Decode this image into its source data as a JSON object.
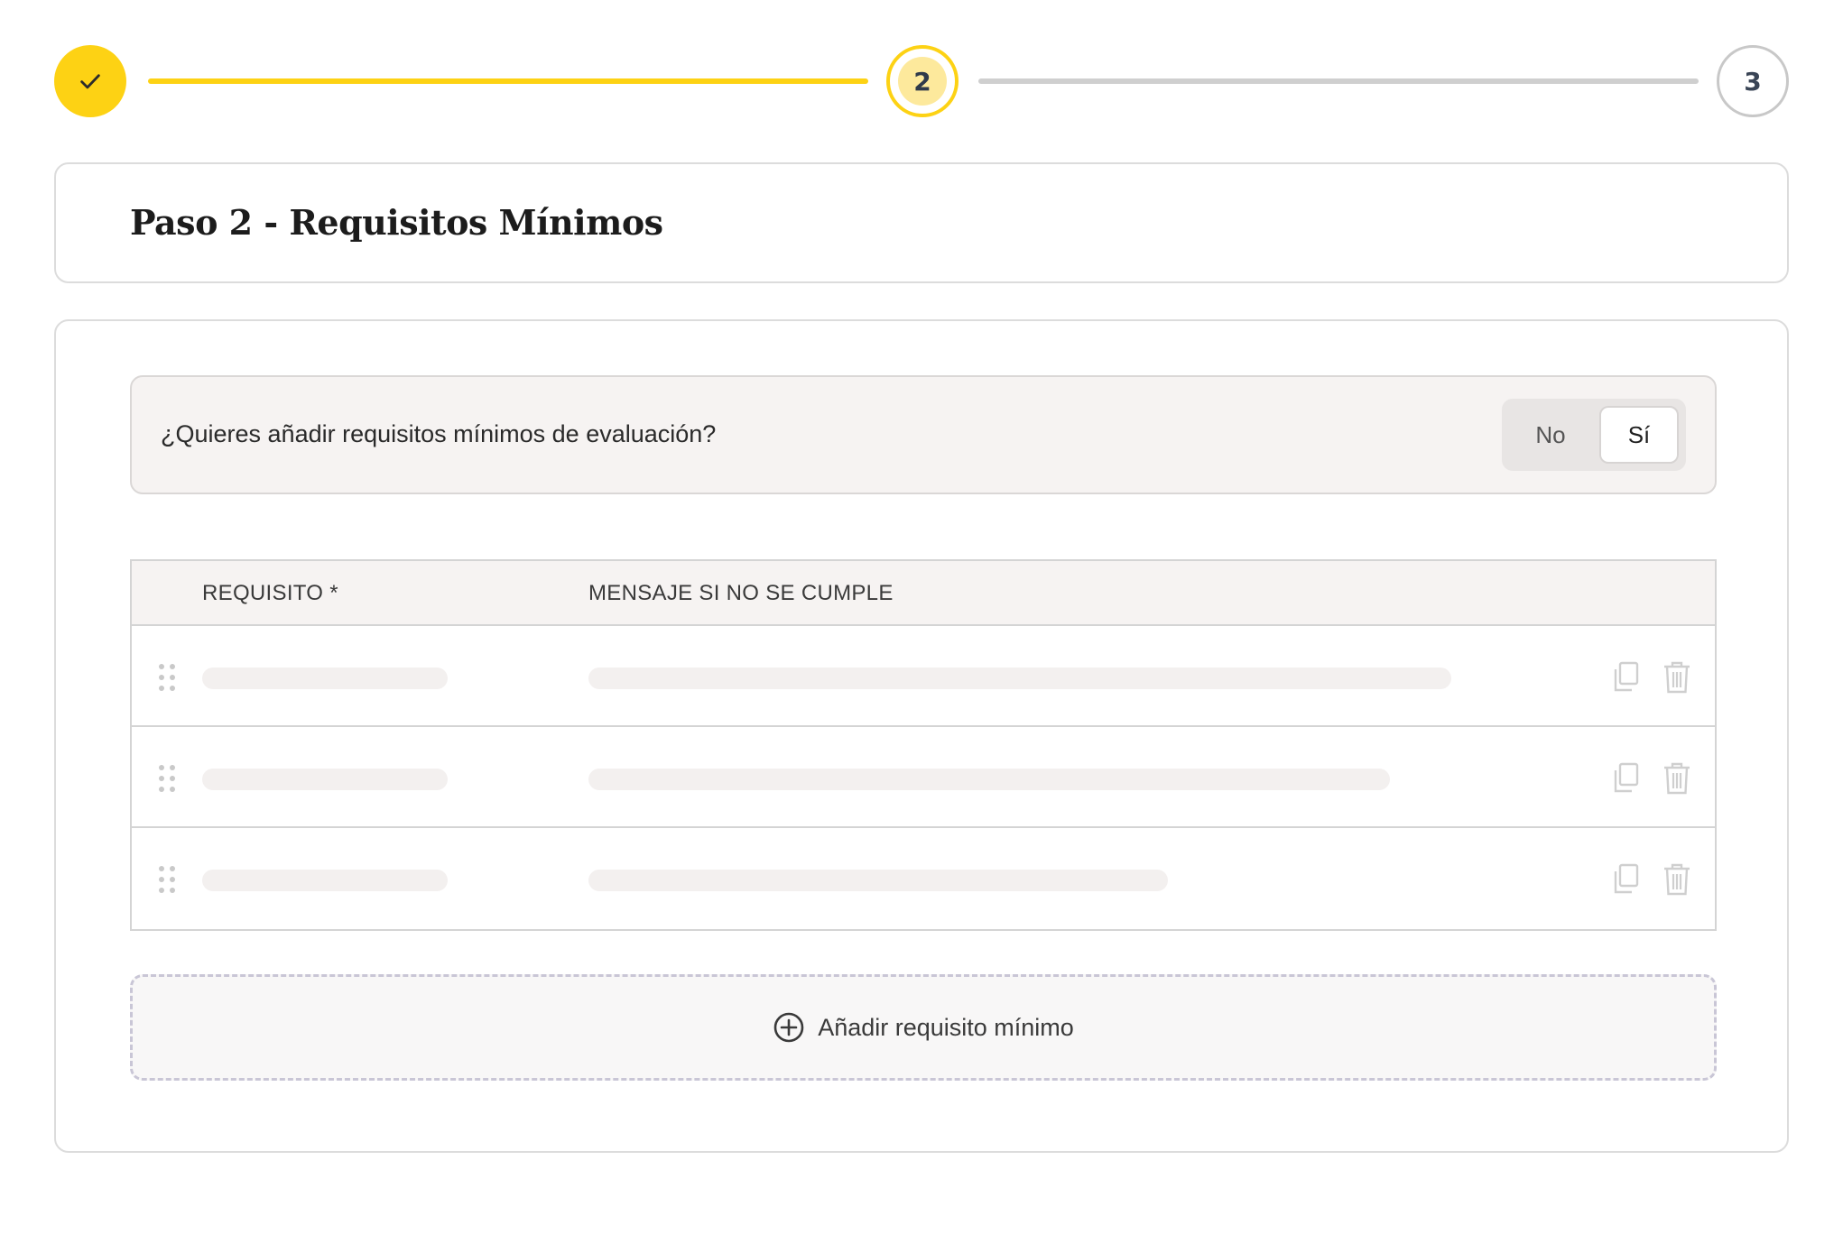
{
  "stepper": {
    "step1": {
      "state": "completed",
      "icon": "check-icon"
    },
    "step2": {
      "label": "2",
      "state": "current"
    },
    "step3": {
      "label": "3",
      "state": "pending"
    }
  },
  "title": "Paso 2 - Requisitos Mínimos",
  "question": {
    "text": "¿Quieres añadir requisitos mínimos de evaluación?",
    "options": [
      "No",
      "Sí"
    ],
    "selected": "Sí"
  },
  "table": {
    "headers": {
      "requirement": "REQUISITO *",
      "message": "MENSAJE SI NO SE CUMPLE"
    },
    "rows": [
      {
        "state": "loading"
      },
      {
        "state": "loading"
      },
      {
        "state": "loading"
      }
    ]
  },
  "add_button": {
    "label": "Añadir requisito mínimo",
    "icon": "plus-circle-icon"
  },
  "colors": {
    "accent": "#fdd214",
    "accent_light": "#fde99c",
    "pending": "#cfcfcf",
    "surface": "#f6f3f2",
    "border": "#d4d4d4"
  }
}
